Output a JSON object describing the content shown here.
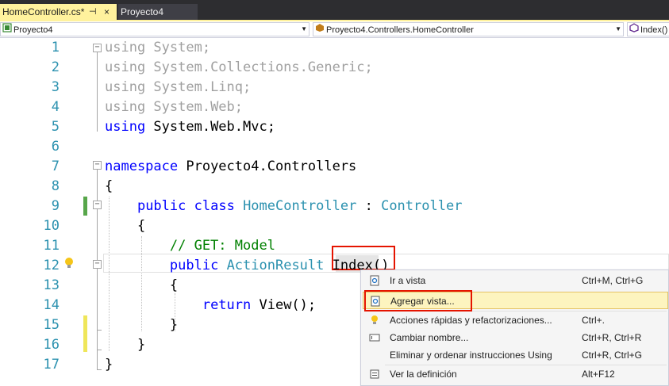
{
  "tabs": [
    {
      "label": "HomeController.cs*",
      "pin": "⊣",
      "close": "×"
    },
    {
      "label": "Proyecto4"
    }
  ],
  "navbar": {
    "project": "Proyecto4",
    "class_scope": "Proyecto4.Controllers.HomeController",
    "member_scope": "Index()"
  },
  "editor": {
    "line_numbers": [
      "1",
      "2",
      "3",
      "4",
      "5",
      "6",
      "7",
      "8",
      "9",
      "10",
      "11",
      "12",
      "13",
      "14",
      "15",
      "16",
      "17"
    ],
    "lines": {
      "l1_kw": "using",
      "l1_rest": " System;",
      "l2_kw": "using",
      "l2_rest": " System.Collections.Generic;",
      "l3_kw": "using",
      "l3_rest": " System.Linq;",
      "l4_kw": "using",
      "l4_rest": " System.Web;",
      "l5_kw": "using",
      "l5_rest": " System.Web.Mvc;",
      "l7_kw": "namespace",
      "l7_rest": " Proyecto4.Controllers",
      "l8": "{",
      "l9_indent": "    ",
      "l9_kw1": "public",
      "l9_sp1": " ",
      "l9_kw2": "class",
      "l9_sp2": " ",
      "l9_type": "HomeController",
      "l9_colon": " : ",
      "l9_base": "Controller",
      "l10": "    {",
      "l11": "        // GET: Model",
      "l12_indent": "        ",
      "l12_kw": "public",
      "l12_sp": " ",
      "l12_type": "ActionResult",
      "l12_sp2": " ",
      "l12_name": "Index",
      "l12_paren": "()",
      "l13": "        {",
      "l14_indent": "            ",
      "l14_kw": "return",
      "l14_rest": " View();",
      "l15": "        }",
      "l16": "    }",
      "l17": "}"
    }
  },
  "context_menu": {
    "items": [
      {
        "label": "Ir a vista",
        "shortcut": "Ctrl+M, Ctrl+G",
        "icon": "go-to-view-icon"
      },
      {
        "label": "Agregar vista...",
        "shortcut": "",
        "icon": "add-view-icon"
      },
      {
        "label": "Acciones rápidas y refactorizaciones...",
        "shortcut": "Ctrl+.",
        "icon": "lightbulb-icon"
      },
      {
        "label": "Cambiar nombre...",
        "shortcut": "Ctrl+R, Ctrl+R",
        "icon": "rename-icon"
      },
      {
        "label": "Eliminar y ordenar instrucciones Using",
        "shortcut": "Ctrl+R, Ctrl+G",
        "icon": ""
      },
      {
        "label": "Ver la definición",
        "shortcut": "Alt+F12",
        "icon": "peek-definition-icon"
      }
    ]
  },
  "colors": {
    "keyword": "#0000ff",
    "type": "#2b91af",
    "comment": "#008000",
    "line_number": "#2b91af",
    "active_tab": "#fff29d",
    "highlight_box": "#e51400"
  }
}
